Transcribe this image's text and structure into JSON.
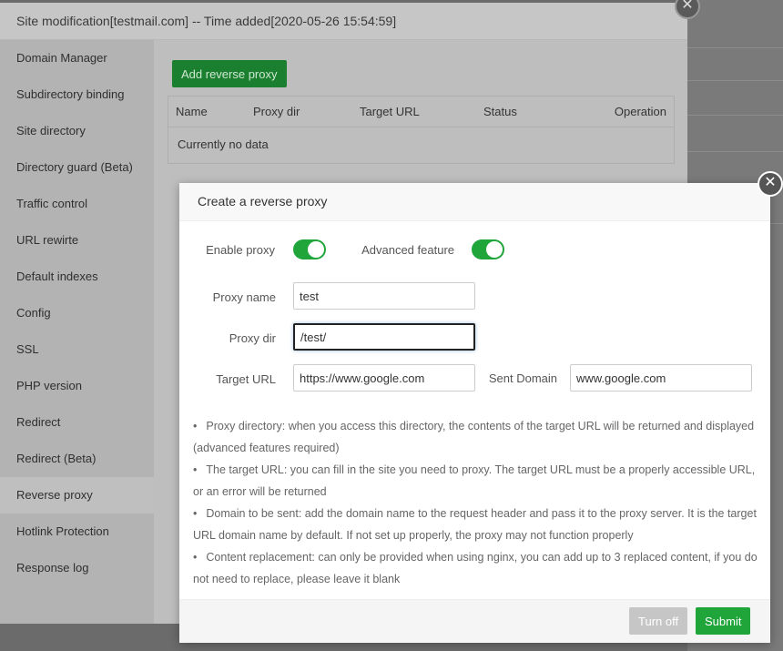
{
  "outer": {
    "title": "Site modification[testmail.com] -- Time added[2020-05-26 15:54:59]",
    "close_icon": "close-icon",
    "sidebar": [
      "Domain Manager",
      "Subdirectory binding",
      "Site directory",
      "Directory guard (Beta)",
      "Traffic control",
      "URL rewirte",
      "Default indexes",
      "Config",
      "SSL",
      "PHP version",
      "Redirect",
      "Redirect (Beta)",
      "Reverse proxy",
      "Hotlink Protection",
      "Response log"
    ],
    "active": "Reverse proxy",
    "add_button": "Add reverse proxy",
    "table": {
      "headers": [
        "Name",
        "Proxy dir",
        "Target URL",
        "Status",
        "Operation"
      ],
      "empty": "Currently no data"
    }
  },
  "dialog": {
    "title": "Create a reverse proxy",
    "enable_proxy": {
      "label": "Enable proxy",
      "on": true
    },
    "advanced": {
      "label": "Advanced feature",
      "on": true
    },
    "proxy_name": {
      "label": "Proxy name",
      "value": "test"
    },
    "proxy_dir": {
      "label": "Proxy dir",
      "value": "/test/"
    },
    "target_url": {
      "label": "Target URL",
      "value": "https://www.google.com"
    },
    "sent_domain": {
      "label": "Sent Domain",
      "value": "www.google.com"
    },
    "tips": [
      "Proxy directory: when you access this directory, the contents of the target URL will be returned and displayed (advanced features required)",
      "The target URL: you can fill in the site you need to proxy. The target URL must be a properly accessible URL, or an error will be returned",
      "Domain to be sent: add the domain name to the request header and pass it to the proxy server. It is the target URL domain name by default. If not set up properly, the proxy may not function properly",
      "Content replacement: can only be provided when using nginx, you can add up to 3 replaced content, if you do not need to replace, please leave it blank"
    ],
    "turn_off": "Turn off",
    "submit": "Submit"
  },
  "colors": {
    "accent": "#20a53a"
  }
}
